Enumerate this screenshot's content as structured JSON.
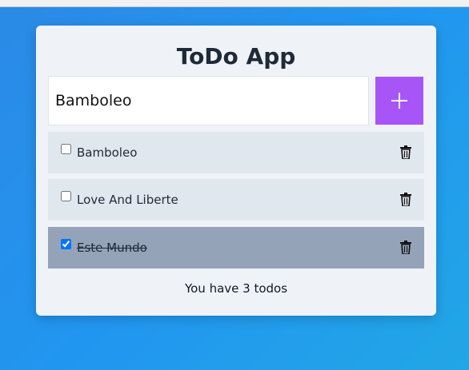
{
  "app": {
    "title": "ToDo App"
  },
  "new_todo": {
    "value": "Bamboleo"
  },
  "add_button": {
    "icon": "plus-icon"
  },
  "todos": [
    {
      "label": "Bamboleo",
      "completed": false,
      "icon": "trash-icon"
    },
    {
      "label": "Love And Liberte",
      "completed": false,
      "icon": "trash-icon"
    },
    {
      "label": "Este Mundo",
      "completed": true,
      "icon": "trash-icon"
    }
  ],
  "footer": {
    "count_text": "You have 3 todos"
  },
  "colors": {
    "accent": "#a855f7",
    "card": "#eff3f8",
    "item": "#e1e7ef",
    "item_done": "#94a3b8",
    "background": "#2196f0"
  }
}
